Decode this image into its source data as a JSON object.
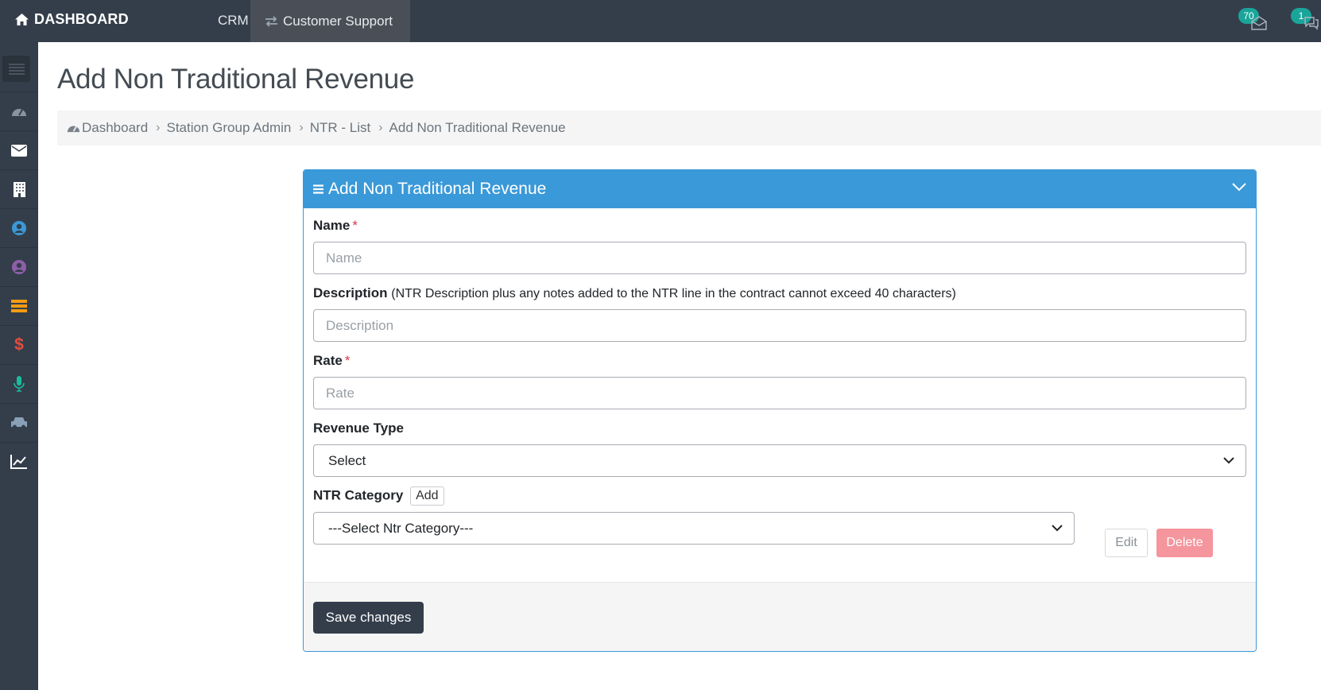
{
  "topbar": {
    "brand": "DASHBOARD",
    "nav_crm": "CRM",
    "nav_support": "Customer Support",
    "mail_count": "70",
    "chat_count": "1"
  },
  "sidebar": {
    "items": [
      {
        "icon": "dashboard-gauge-icon",
        "color": "#8a939e"
      },
      {
        "icon": "envelope-icon",
        "color": "#ffffff"
      },
      {
        "icon": "building-icon",
        "color": "#ffffff"
      },
      {
        "icon": "user-circle-icon",
        "color": "#3a99d8"
      },
      {
        "icon": "user-circle-icon",
        "color": "#8e5ea8"
      },
      {
        "icon": "server-icon",
        "color": "#f39c12"
      },
      {
        "icon": "dollar-icon",
        "color": "#e74c3c"
      },
      {
        "icon": "microphone-icon",
        "color": "#1abc9c"
      },
      {
        "icon": "car-icon",
        "color": "#8aa0b6"
      },
      {
        "icon": "line-chart-icon",
        "color": "#ffffff"
      }
    ]
  },
  "page": {
    "title": "Add Non Traditional Revenue"
  },
  "breadcrumb": {
    "items": [
      "Dashboard",
      "Station Group Admin",
      "NTR - List",
      "Add Non Traditional Revenue"
    ]
  },
  "card": {
    "title": "Add Non Traditional Revenue",
    "fields": {
      "name_label": "Name",
      "name_placeholder": "Name",
      "description_label": "Description",
      "description_note": "(NTR Description plus any notes added to the NTR line in the contract cannot exceed 40 characters)",
      "description_placeholder": "Description",
      "rate_label": "Rate",
      "rate_placeholder": "Rate",
      "revenue_type_label": "Revenue Type",
      "revenue_type_value": "Select",
      "ntr_category_label": "NTR Category",
      "ntr_category_add": "Add",
      "ntr_category_value": "---Select Ntr Category---",
      "required_mark": "*"
    },
    "edit_label": "Edit",
    "delete_label": "Delete",
    "save_label": "Save changes"
  },
  "colors": {
    "navbar": "#343e4b",
    "card_header": "#3a99d8",
    "badge": "#1aa59a",
    "delete": "#f5959d",
    "required": "#dc3545"
  }
}
